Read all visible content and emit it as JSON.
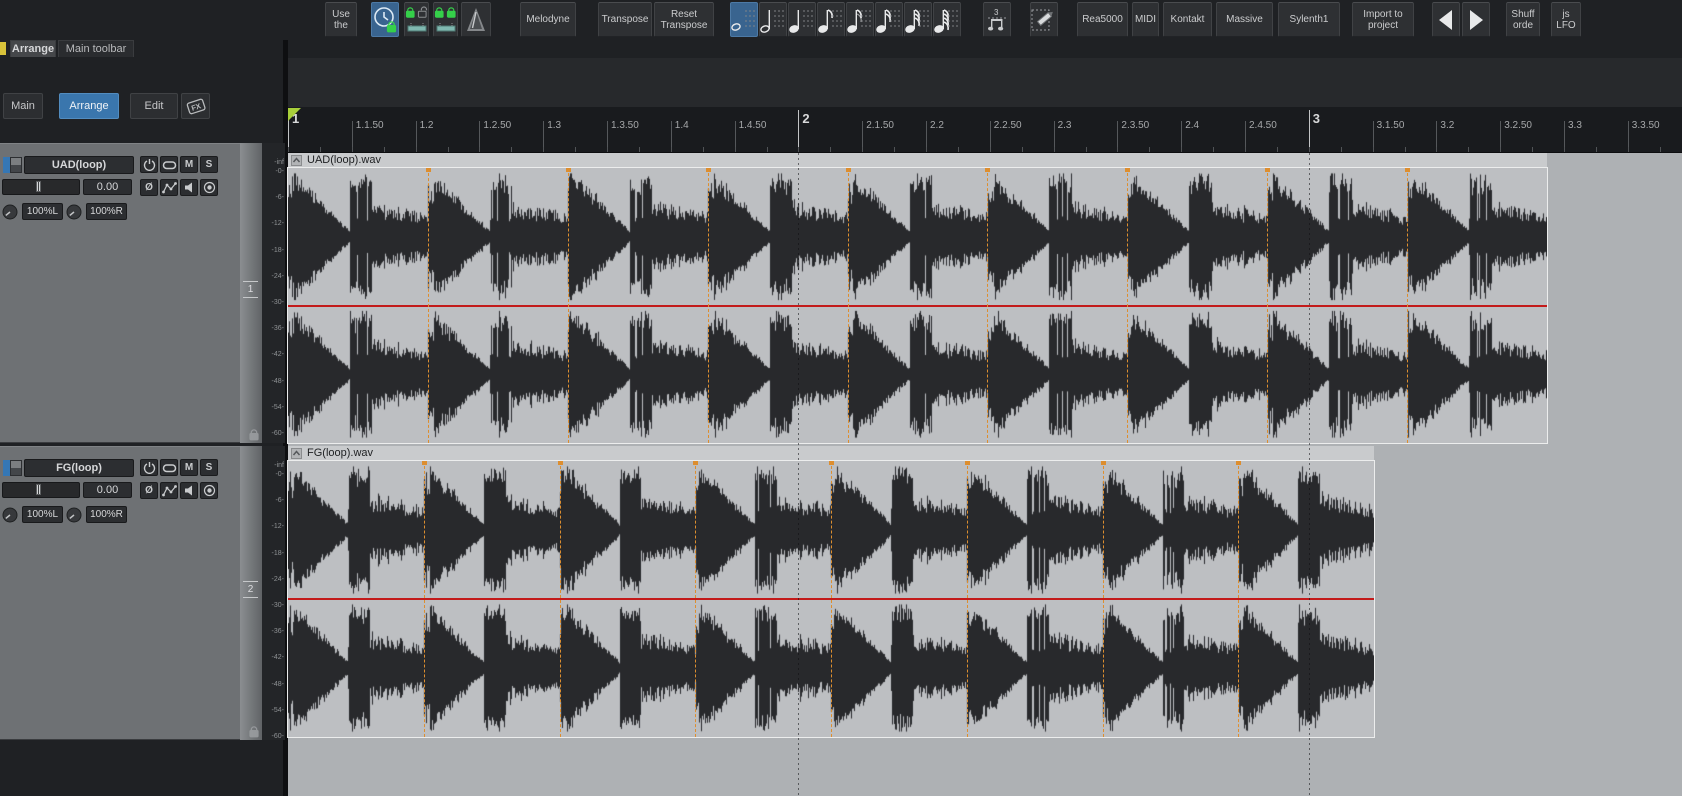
{
  "window": {
    "tabs": [
      {
        "label": "Arrange",
        "active": true
      },
      {
        "label": "Main toolbar",
        "active": false
      }
    ]
  },
  "toolbar": {
    "buttons": [
      {
        "name": "use-the-button",
        "label": "Use\nthe"
      },
      {
        "name": "time-lock-button",
        "icon": "clock-lock",
        "active": true
      },
      {
        "name": "lock-pair-mixed-button",
        "icon": "locks-mixed"
      },
      {
        "name": "lock-pair-green-button",
        "icon": "locks-green"
      },
      {
        "name": "metronome-button",
        "icon": "metronome"
      },
      {
        "name": "melodyne-button",
        "label": "Melodyne"
      },
      {
        "name": "transpose-button",
        "label": "Transpose"
      },
      {
        "name": "reset-transpose-button",
        "label": "Reset\nTranspose"
      },
      {
        "name": "grid-whole-note-button",
        "icon": "note-whole",
        "active": true
      },
      {
        "name": "grid-half-note-button",
        "icon": "note-half"
      },
      {
        "name": "grid-quarter-note-button",
        "icon": "note-quarter"
      },
      {
        "name": "grid-eighth-note-button",
        "icon": "note-eighth"
      },
      {
        "name": "grid-eighth-note-b-button",
        "icon": "note-eighth-b"
      },
      {
        "name": "grid-sixteenth-note-button",
        "icon": "note-sixteenth"
      },
      {
        "name": "grid-thirtysecond-note-button",
        "icon": "note-thirtysecond"
      },
      {
        "name": "grid-sixtyfourth-note-button",
        "icon": "note-sixtyfourth"
      },
      {
        "name": "triplet-grid-button",
        "icon": "triplet"
      },
      {
        "name": "draw-grid-button",
        "icon": "pencil-grid"
      },
      {
        "name": "rea5000-button",
        "label": "Rea5000"
      },
      {
        "name": "midi-button",
        "label": "MIDI"
      },
      {
        "name": "kontakt-button",
        "label": "Kontakt"
      },
      {
        "name": "massive-button",
        "label": "Massive"
      },
      {
        "name": "sylenth1-button",
        "label": "Sylenth1"
      },
      {
        "name": "import-to-project-button",
        "label": "Import to\nproject"
      },
      {
        "name": "nav-previous-button",
        "icon": "arrow-left"
      },
      {
        "name": "nav-next-button",
        "icon": "arrow-right"
      },
      {
        "name": "shuffle-order-button",
        "label": "Shuff\norde"
      },
      {
        "name": "js-lfo-button",
        "label": "js\nLFO"
      }
    ]
  },
  "dock": {
    "tabs": [
      {
        "label": "Main",
        "active": false
      },
      {
        "label": "Arrange",
        "active": true
      },
      {
        "label": "Edit",
        "active": false
      }
    ]
  },
  "ruler": {
    "labels": [
      "1",
      "1.1.50",
      "1.2",
      "1.2.50",
      "1.3",
      "1.3.50",
      "1.4",
      "1.4.50",
      "2",
      "2.1.50",
      "2.2",
      "2.2.50",
      "2.3",
      "2.3.50",
      "2.4",
      "2.4.50",
      "3",
      "3.1.50",
      "3.2",
      "3.2.50",
      "3.3",
      "3.3.50"
    ]
  },
  "db_scale": [
    "-inf",
    "-0-",
    "-6-",
    "-12-",
    "-18-",
    "-24-",
    "-30-",
    "-36-",
    "-42-",
    "-48-",
    "-54-",
    "-60-"
  ],
  "tracks": [
    {
      "number": "1",
      "name": "UAD(loop)",
      "volume": "0.00",
      "pan_left": "100%L",
      "pan_right": "100%R",
      "buttons_row1": [
        "power",
        "capsule",
        "M",
        "S"
      ],
      "buttons_row2": [
        "phase",
        "envelope",
        "speaker",
        "record"
      ],
      "item": {
        "label": "UAD(loop).wav",
        "segments": 9
      }
    },
    {
      "number": "2",
      "name": "FG(loop)",
      "volume": "0.00",
      "pan_left": "100%L",
      "pan_right": "100%R",
      "buttons_row1": [
        "power",
        "capsule",
        "M",
        "S"
      ],
      "buttons_row2": [
        "phase",
        "envelope",
        "speaker",
        "record"
      ],
      "item": {
        "label": "FG(loop).wav",
        "segments": 8
      }
    }
  ],
  "colors": {
    "accent_blue": "#3a76ad",
    "marker_orange": "#dd8e2f",
    "center_line_red": "#c31a1a",
    "lock_green": "#35d04a",
    "ruler_marker_lime": "#a8cf3a"
  }
}
